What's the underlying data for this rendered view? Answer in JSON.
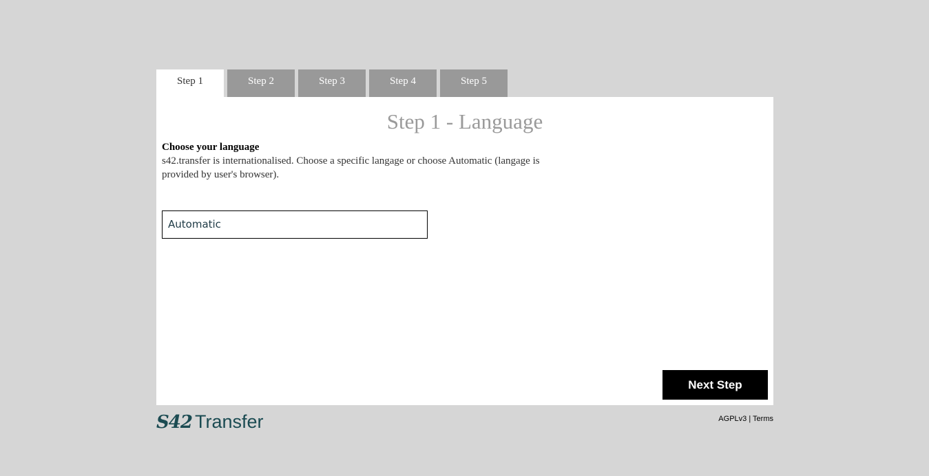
{
  "tabs": [
    {
      "label": "Step 1",
      "active": true
    },
    {
      "label": "Step 2",
      "active": false
    },
    {
      "label": "Step 3",
      "active": false
    },
    {
      "label": "Step 4",
      "active": false
    },
    {
      "label": "Step 5",
      "active": false
    }
  ],
  "panel": {
    "title": "Step 1 - Language",
    "heading": "Choose your language",
    "description": "s42.transfer is internationalised. Choose a specific langage or choose Automatic (langage is provided by user's browser).",
    "language_select": {
      "selected": "Automatic"
    },
    "next_button": "Next Step"
  },
  "footer": {
    "logo_mark": "S42",
    "logo_text": "Transfer",
    "license_link": "AGPLv3",
    "separator": "|",
    "terms_link": "Terms"
  },
  "colors": {
    "background": "#d6d6d6",
    "tab_inactive": "#999999",
    "tab_active": "#ffffff",
    "title_gray": "#9a9a9a",
    "brand": "#1b4b52",
    "button": "#000000"
  }
}
